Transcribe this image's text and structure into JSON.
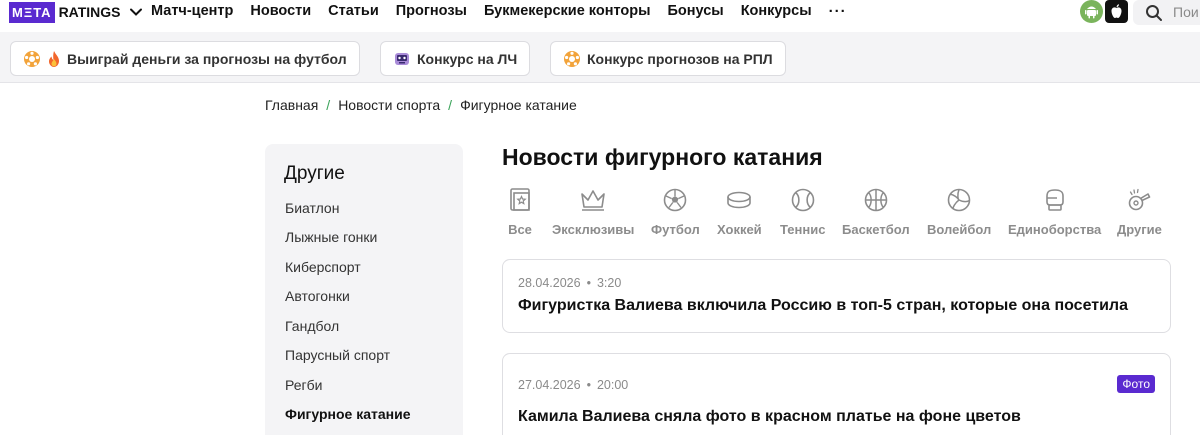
{
  "header": {
    "logo_box": "MΞTA",
    "logo_text": "RATINGS",
    "nav": [
      "Матч-центр",
      "Новости",
      "Статьи",
      "Прогнозы",
      "Букмекерские конторы",
      "Бонусы",
      "Конкурсы"
    ],
    "more": "···",
    "search_placeholder": "Пои"
  },
  "promos": [
    {
      "label": "Выиграй деньги за прогнозы на футбол",
      "icon": "football-fire-icon"
    },
    {
      "label": "Конкурс на ЛЧ",
      "icon": "champions-league-icon"
    },
    {
      "label": "Конкурс прогнозов на РПЛ",
      "icon": "football-icon"
    }
  ],
  "breadcrumb": [
    "Главная",
    "Новости спорта",
    "Фигурное катание"
  ],
  "sidebar": {
    "title": "Другие",
    "items": [
      "Биатлон",
      "Лыжные гонки",
      "Киберспорт",
      "Автогонки",
      "Гандбол",
      "Парусный спорт",
      "Регби",
      "Фигурное катание"
    ],
    "active": "Фигурное катание"
  },
  "main": {
    "title": "Новости фигурного катания",
    "sports": [
      {
        "label": "Все",
        "icon": "all-news-icon"
      },
      {
        "label": "Эксклюзивы",
        "icon": "crown-icon"
      },
      {
        "label": "Футбол",
        "icon": "football-icon"
      },
      {
        "label": "Хоккей",
        "icon": "hockey-puck-icon"
      },
      {
        "label": "Теннис",
        "icon": "tennis-ball-icon"
      },
      {
        "label": "Баскетбол",
        "icon": "basketball-icon"
      },
      {
        "label": "Волейбол",
        "icon": "volleyball-icon"
      },
      {
        "label": "Единоборства",
        "icon": "boxing-glove-icon"
      },
      {
        "label": "Другие",
        "icon": "whistle-icon"
      }
    ],
    "articles": [
      {
        "date": "28.04.2026",
        "time": "3:20",
        "title": "Фигуристка Валиева включила Россию в топ-5 стран, которые она посетила",
        "badge": ""
      },
      {
        "date": "27.04.2026",
        "time": "20:00",
        "title": "Камила Валиева сняла фото в красном платье на фоне цветов",
        "badge": "Фото"
      }
    ]
  },
  "colors": {
    "brand": "#5a2ad0",
    "breadcrumb_separator": "#3aa35a",
    "muted": "#8c8c8c"
  }
}
